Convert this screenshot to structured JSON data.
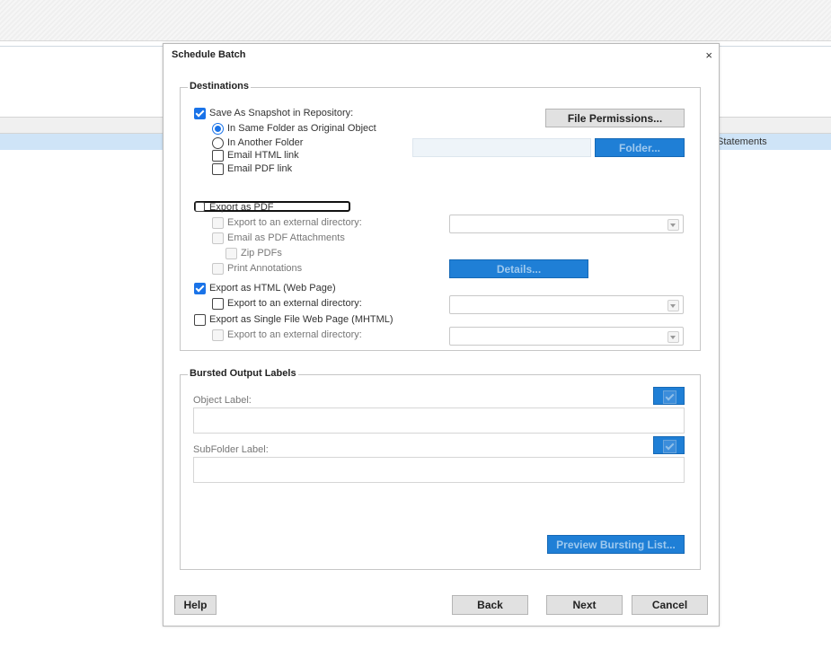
{
  "background": {
    "row_text": "Statements"
  },
  "dialog": {
    "title": "Schedule Batch",
    "close_glyph": "×"
  },
  "destinations": {
    "legend": "Destinations",
    "save_snapshot": {
      "label": "Save As Snapshot in Repository:",
      "checked": true
    },
    "same_folder": {
      "label": "In Same Folder as Original Object",
      "selected": true
    },
    "another_folder": {
      "label": "In Another Folder",
      "selected": false
    },
    "email_html": {
      "label": "Email HTML link",
      "checked": false
    },
    "email_pdf": {
      "label": "Email PDF link",
      "checked": false
    },
    "file_permissions_button": "File Permissions...",
    "folder_button": "Folder...",
    "export_pdf": {
      "label": "Export as PDF",
      "checked": false
    },
    "pdf_external_dir": {
      "label": "Export to an external directory:",
      "checked": false
    },
    "pdf_email_attach": {
      "label": "Email as PDF Attachments",
      "checked": false
    },
    "zip_pdfs": {
      "label": "Zip PDFs",
      "checked": false
    },
    "print_annotations": {
      "label": "Print Annotations",
      "checked": false
    },
    "details_button": "Details...",
    "export_html": {
      "label": "Export as HTML (Web Page)",
      "checked": true
    },
    "html_external_dir": {
      "label": "Export to an external directory:",
      "checked": false
    },
    "export_mhtml": {
      "label": "Export as Single File Web Page (MHTML)",
      "checked": false
    },
    "mhtml_external_dir": {
      "label": "Export to an external directory:",
      "checked": false
    }
  },
  "bursted": {
    "legend": "Bursted Output Labels",
    "object_label": "Object Label:",
    "object_value": "",
    "subfolder_label": "SubFolder Label:",
    "subfolder_value": "",
    "preview_button": "Preview Bursting List..."
  },
  "footer": {
    "help": "Help",
    "back": "Back",
    "next": "Next",
    "cancel": "Cancel"
  },
  "colors": {
    "accent": "#1f7fd6",
    "selected_row": "#cfe4f7"
  }
}
